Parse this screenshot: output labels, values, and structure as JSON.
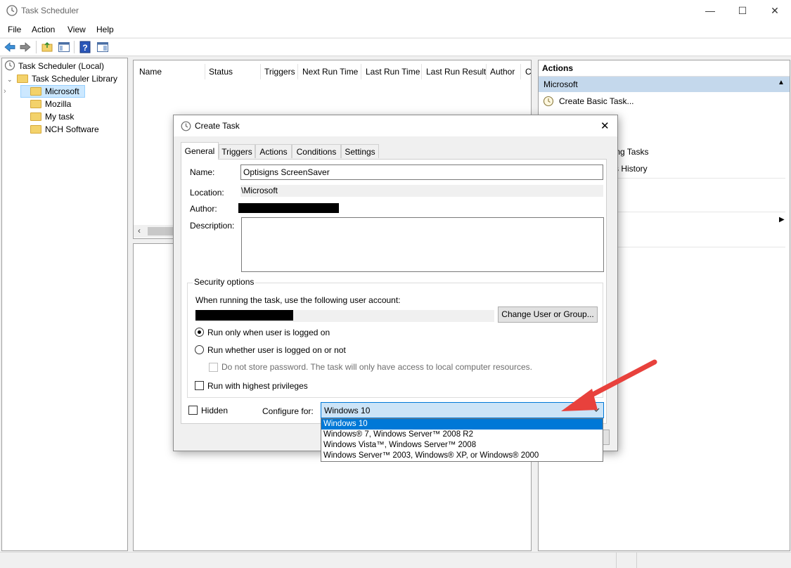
{
  "window": {
    "title": "Task Scheduler",
    "minimize": "—",
    "maximize": "☐",
    "close": "✕"
  },
  "menu": [
    "File",
    "Action",
    "View",
    "Help"
  ],
  "tree": {
    "root": "Task Scheduler (Local)",
    "library": "Task Scheduler Library",
    "folders": [
      "Microsoft",
      "Mozilla",
      "My task",
      "NCH Software"
    ]
  },
  "task_list": {
    "columns": [
      "Name",
      "Status",
      "Triggers",
      "Next Run Time",
      "Last Run Time",
      "Last Run Result",
      "Author",
      "C"
    ]
  },
  "actions_pane": {
    "header": "Actions",
    "section": "Microsoft",
    "items": [
      "Create Basic Task...",
      "ning Tasks",
      "s History"
    ]
  },
  "dialog": {
    "title": "Create Task",
    "close": "✕",
    "tabs": [
      "General",
      "Triggers",
      "Actions",
      "Conditions",
      "Settings"
    ],
    "name_label": "Name:",
    "name_value": "Optisigns ScreenSaver",
    "location_label": "Location:",
    "location_value": "\\Microsoft",
    "author_label": "Author:",
    "description_label": "Description:",
    "security": {
      "group_label": "Security options",
      "account_prompt": "When running the task, use the following user account:",
      "change_user_button": "Change User or Group...",
      "radio_logged_on": "Run only when user is logged on",
      "radio_whether": "Run whether user is logged on or not",
      "no_store_password": "Do not store password.  The task will only have access to local computer resources.",
      "highest_privileges": "Run with highest privileges"
    },
    "hidden_label": "Hidden",
    "configure_label": "Configure for:",
    "configure_value": "Windows 10",
    "configure_options": [
      "Windows 10",
      "Windows® 7, Windows Server™ 2008 R2",
      "Windows Vista™, Windows Server™ 2008",
      "Windows Server™ 2003, Windows® XP, or Windows® 2000"
    ]
  },
  "colors": {
    "selection": "#0078d7",
    "selected_folder_bg": "#cce8ff",
    "actions_section_bg": "#c4d8ec",
    "dropdown_bg": "#cce4f7",
    "arrow": "#e8413c"
  }
}
